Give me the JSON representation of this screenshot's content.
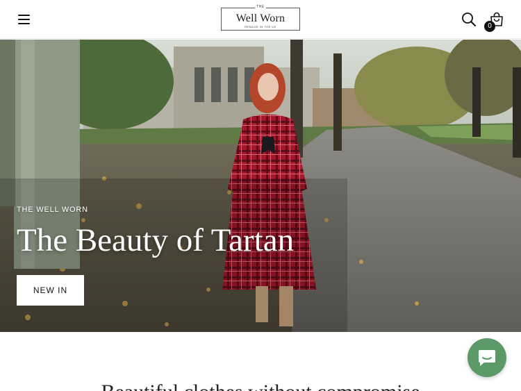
{
  "header": {
    "menu_icon": "hamburger-menu-icon",
    "logo": {
      "top": "THE",
      "main": "Well Worn",
      "sub": "REMADE IN THE UK"
    },
    "search_icon": "search-icon",
    "cart_icon": "shopping-bag-icon",
    "cart_count": "0"
  },
  "hero": {
    "eyebrow": "THE WELL WORN",
    "title": "The Beauty of Tartan",
    "cta_label": "NEW IN"
  },
  "content": {
    "heading": "Beautiful clothes without compromise"
  },
  "chat": {
    "icon": "chat-bubble-icon",
    "color": "#5b9a68"
  },
  "colors": {
    "cart_badge": "#111111",
    "hero_text": "#ffffff"
  }
}
